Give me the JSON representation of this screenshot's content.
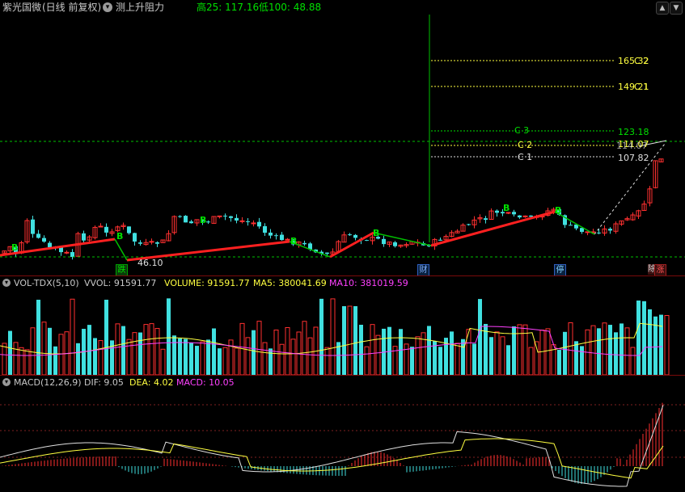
{
  "topbar": {
    "stock_name": "紫光国微",
    "period": "(日线 前复权)",
    "dropdown_icon": "chevron-down-icon",
    "indicator_name": "测上升阻力",
    "high_label": "高25: 117.16",
    "low_label": "低100: 48.88",
    "colors": {
      "text": "#c8c8c8",
      "high": "#00e000",
      "low": "#00e000"
    }
  },
  "main_chart": {
    "fib_levels": [
      {
        "label": "C 3",
        "value": "123.18",
        "color": "#00e000"
      },
      {
        "label": "C 2",
        "value": "111.07",
        "color": "#ffff40"
      },
      {
        "label": "C 1",
        "value": "107.82",
        "color": "#e0e0e0"
      }
    ],
    "upper_levels": [
      {
        "value": "165.32",
        "marker": "C 2",
        "color": "#ffff40"
      },
      {
        "value": "149.21",
        "marker": "C 1",
        "color": "#ffff40"
      }
    ],
    "overlap_label": "114.07",
    "low_price_label": "46.10",
    "b_markers": [
      "B",
      "B",
      "B",
      "B",
      "B",
      "B",
      "B"
    ],
    "event_tags": [
      {
        "text": "跌",
        "color": "#00e000"
      },
      {
        "text": "财",
        "color": "#4080ff"
      },
      {
        "text": "停",
        "color": "#4080ff"
      },
      {
        "text": "除",
        "color": "#e0e0e0"
      },
      {
        "text": "涨",
        "color": "#ff3030"
      }
    ],
    "up_color": "#ff3030",
    "down_color": "#40e0e0"
  },
  "volume_panel": {
    "name": "VOL-TDX(5,10)",
    "vvol": "VVOL: 91591.77",
    "volume": "VOLUME: 91591.77",
    "ma5": "MA5: 380041.69",
    "ma10": "MA10: 381019.59",
    "colors": {
      "name": "#c8c8c8",
      "vvol": "#c8c8c8",
      "volume": "#ffff40",
      "ma5": "#ffff40",
      "ma10": "#ff40ff"
    }
  },
  "macd_panel": {
    "name": "MACD(12,26,9)",
    "dif": "DIF: 9.05",
    "dea": "DEA: 4.02",
    "macd": "MACD: 10.05",
    "colors": {
      "name": "#c8c8c8",
      "dif": "#c8c8c8",
      "dea": "#ffff40",
      "macd": "#ff40ff"
    }
  },
  "scroll_icons": [
    "chevron-up-icon",
    "chevron-down-icon"
  ]
}
